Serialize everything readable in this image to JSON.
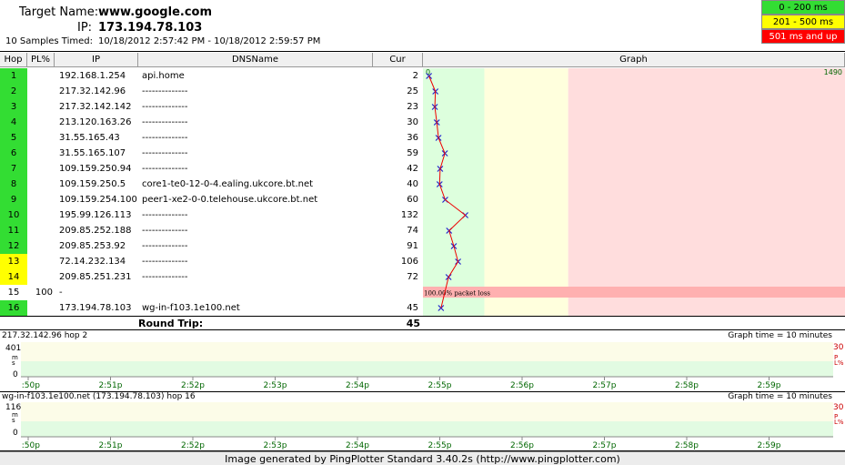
{
  "header": {
    "target_label": "Target Name:",
    "target_value": "www.google.com",
    "ip_label": "IP:",
    "ip_value": "173.194.78.103",
    "samples_label": "10 Samples Timed:",
    "samples_value": "10/18/2012 2:57:42 PM - 10/18/2012 2:59:57 PM"
  },
  "legend": {
    "green": "0 - 200 ms",
    "yellow": "201 - 500 ms",
    "red": "501 ms and up",
    "green_color": "#33dd33",
    "yellow_color": "#ffff00",
    "red_color": "#ff0000"
  },
  "columns": {
    "hop": "Hop",
    "pl": "PL%",
    "ip": "IP",
    "dns": "DNSName",
    "cur": "Cur",
    "graph": "Graph"
  },
  "graph_scale": {
    "min": "0",
    "max": "1490"
  },
  "hops": [
    {
      "hop": "1",
      "pl": "",
      "ip": "192.168.1.254",
      "dns": "api.home",
      "cur": "2",
      "color": "green"
    },
    {
      "hop": "2",
      "pl": "",
      "ip": "217.32.142.96",
      "dns": "--------------",
      "cur": "25",
      "color": "green"
    },
    {
      "hop": "3",
      "pl": "",
      "ip": "217.32.142.142",
      "dns": "--------------",
      "cur": "23",
      "color": "green"
    },
    {
      "hop": "4",
      "pl": "",
      "ip": "213.120.163.26",
      "dns": "--------------",
      "cur": "30",
      "color": "green"
    },
    {
      "hop": "5",
      "pl": "",
      "ip": "31.55.165.43",
      "dns": "--------------",
      "cur": "36",
      "color": "green"
    },
    {
      "hop": "6",
      "pl": "",
      "ip": "31.55.165.107",
      "dns": "--------------",
      "cur": "59",
      "color": "green"
    },
    {
      "hop": "7",
      "pl": "",
      "ip": "109.159.250.94",
      "dns": "--------------",
      "cur": "42",
      "color": "green"
    },
    {
      "hop": "8",
      "pl": "",
      "ip": "109.159.250.5",
      "dns": "core1-te0-12-0-4.ealing.ukcore.bt.net",
      "cur": "40",
      "color": "green"
    },
    {
      "hop": "9",
      "pl": "",
      "ip": "109.159.254.100",
      "dns": "peer1-xe2-0-0.telehouse.ukcore.bt.net",
      "cur": "60",
      "color": "green"
    },
    {
      "hop": "10",
      "pl": "",
      "ip": "195.99.126.113",
      "dns": "--------------",
      "cur": "132",
      "color": "green"
    },
    {
      "hop": "11",
      "pl": "",
      "ip": "209.85.252.188",
      "dns": "--------------",
      "cur": "74",
      "color": "green"
    },
    {
      "hop": "12",
      "pl": "",
      "ip": "209.85.253.92",
      "dns": "--------------",
      "cur": "91",
      "color": "green"
    },
    {
      "hop": "13",
      "pl": "",
      "ip": "72.14.232.134",
      "dns": "--------------",
      "cur": "106",
      "color": "yellow"
    },
    {
      "hop": "14",
      "pl": "",
      "ip": "209.85.251.231",
      "dns": "--------------",
      "cur": "72",
      "color": "yellow"
    },
    {
      "hop": "15",
      "pl": "100",
      "ip": "-",
      "dns": "",
      "cur": "",
      "color": "white"
    },
    {
      "hop": "16",
      "pl": "",
      "ip": "173.194.78.103",
      "dns": "wg-in-f103.1e100.net",
      "cur": "45",
      "color": "green"
    }
  ],
  "packet_loss_label": "100.00% packet loss",
  "roundtrip": {
    "label": "Round Trip:",
    "value": "45"
  },
  "mini1": {
    "title": "217.32.142.96 hop 2",
    "graph_time": "Graph time = 10 minutes",
    "ymax": "401",
    "ymin": "0",
    "yunit": "ms",
    "pl_max": "30",
    "pl_unit": "PL%"
  },
  "mini2": {
    "title": "wg-in-f103.1e100.net (173.194.78.103) hop 16",
    "graph_time": "Graph time = 10 minutes",
    "ymax": "116",
    "ymin": "0",
    "yunit": "ms",
    "pl_max": "30",
    "pl_unit": "PL%"
  },
  "time_ticks": [
    "2:50p",
    "2:51p",
    "2:52p",
    "2:53p",
    "2:54p",
    "2:55p",
    "2:56p",
    "2:57p",
    "2:58p",
    "2:59p"
  ],
  "footer": "Image generated by PingPlotter Standard 3.40.2s (http://www.pingplotter.com)"
}
